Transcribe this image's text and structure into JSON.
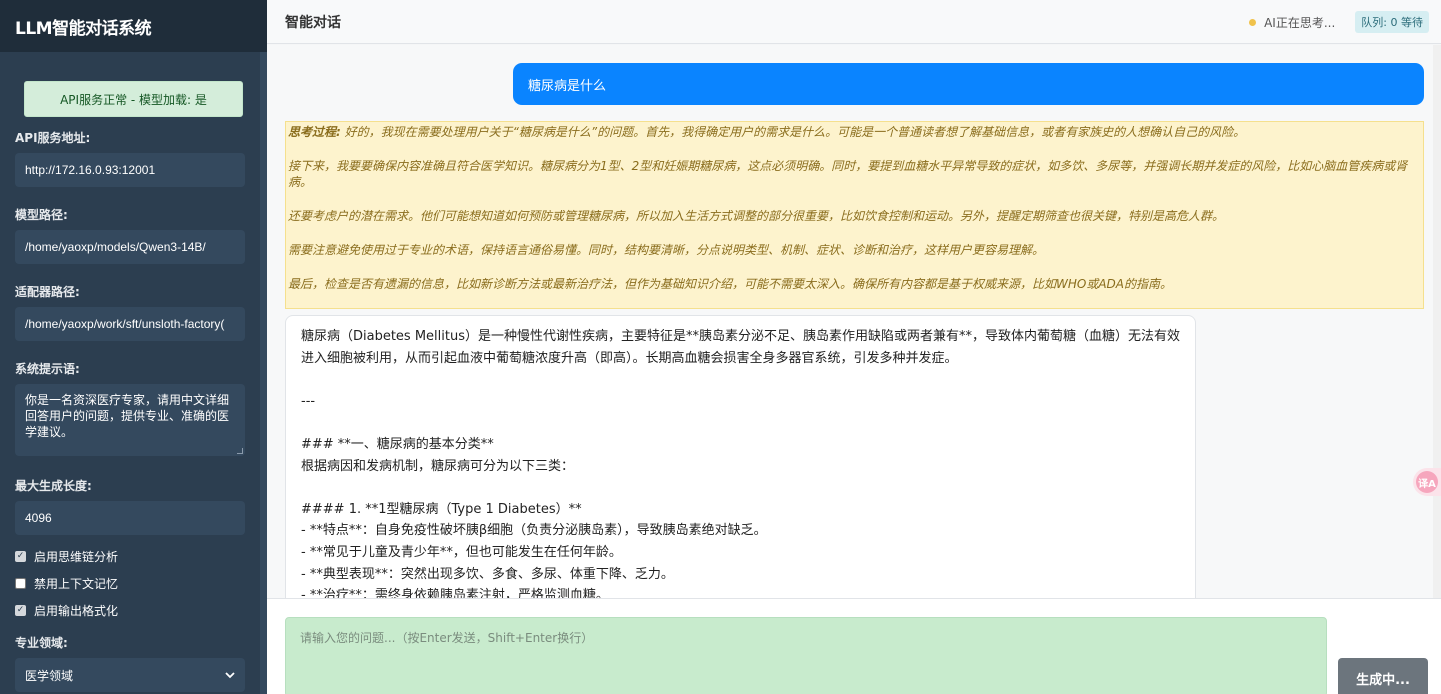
{
  "app": {
    "title": "LLM智能对话系统"
  },
  "sidebar": {
    "status": "API服务正常 - 模型加载: 是",
    "api_url": {
      "label": "API服务地址:",
      "value": "http://172.16.0.93:12001"
    },
    "model_path": {
      "label": "模型路径:",
      "value": "/home/yaoxp/models/Qwen3-14B/"
    },
    "adapter_path": {
      "label": "适配器路径:",
      "value": "/home/yaoxp/work/sft/unsloth-factory("
    },
    "system_prompt": {
      "label": "系统提示语:",
      "value": "你是一名资深医疗专家，请用中文详细回答用户的问题，提供专业、准确的医学建议。"
    },
    "max_length": {
      "label": "最大生成长度:",
      "value": "4096"
    },
    "options": [
      {
        "label": "启用思维链分析",
        "checked": true
      },
      {
        "label": "禁用上下文记忆",
        "checked": false
      },
      {
        "label": "启用输出格式化",
        "checked": true
      }
    ],
    "domain": {
      "label": "专业领域:",
      "value": "医学领域"
    }
  },
  "header": {
    "title": "智能对话",
    "thinking_status": "AI正在思考...",
    "queue": "队列: 0 等待"
  },
  "chat": {
    "user_message": "糖尿病是什么",
    "thinking": {
      "label": "思考过程:",
      "paragraphs": [
        "好的，我现在需要处理用户关于“糖尿病是什么”的问题。首先，我得确定用户的需求是什么。可能是一个普通读者想了解基础信息，或者有家族史的人想确认自己的风险。",
        "接下来，我要要确保内容准确且符合医学知识。糖尿病分为1型、2型和妊娠期糖尿病，这点必须明确。同时，要提到血糖水平异常导致的症状，如多饮、多尿等，并强调长期并发症的风险，比如心脑血管疾病或肾病。",
        "还要考虑户的潜在需求。他们可能想知道如何预防或管理糖尿病，所以加入生活方式调整的部分很重要，比如饮食控制和运动。另外，提醒定期筛查也很关键，特别是高危人群。",
        "需要注意避免使用过于专业的术语，保持语言通俗易懂。同时，结构要清晰，分点说明类型、机制、症状、诊断和治疗，这样用户更容易理解。",
        "最后，检查是否有遗漏的信息，比如新诊断方法或最新治疗法，但作为基础知识介绍，可能不需要太深入。确保所有内容都是基于权威来源，比如WHO或ADA的指南。"
      ]
    },
    "answer": {
      "intro": "糖尿病（Diabetes Mellitus）是一种慢性代谢性疾病，主要特征是**胰岛素分泌不足、胰岛素作用缺陷或两者兼有**，导致体内葡萄糖（血糖）无法有效进入细胞被利用，从而引起血液中葡萄糖浓度升高（即高）。长期高血糖会损害全身多器官系统，引发多种并发症。",
      "separator": "---",
      "h3": "### **一、糖尿病的基本分类**",
      "h3_desc": "根据病因和发病机制，糖尿病可分为以下三类：",
      "h4": "#### 1. **1型糖尿病（Type 1 Diabetes）**",
      "bullets": [
        "- **特点**：自身免疫性破坏胰β细胞（负责分泌胰岛素），导致胰岛素绝对缺乏。",
        "- **常见于儿童及青少年**，但也可能发生在任何年龄。",
        "- **典型表现**：突然出现多饮、多食、多尿、体重下降、乏力。",
        "- **治疗**：需终身依赖胰岛素注射，严格监测血糖。"
      ]
    },
    "float_icon": "译A"
  },
  "input": {
    "placeholder": "请输入您的问题...（按Enter发送，Shift+Enter换行）",
    "send_label": "生成中..."
  }
}
